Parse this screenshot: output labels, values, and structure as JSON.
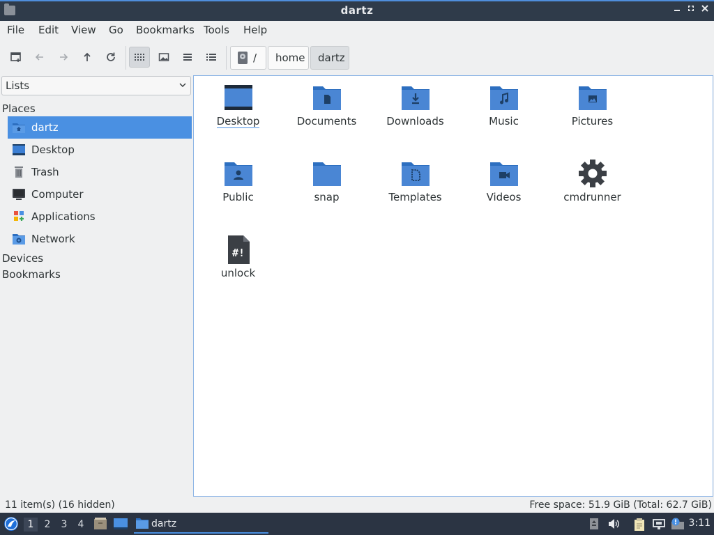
{
  "window": {
    "title": "dartz"
  },
  "menubar": {
    "items": [
      "File",
      "Edit",
      "View",
      "Go",
      "Bookmarks",
      "Tools",
      "Help"
    ]
  },
  "toolbar": {
    "buttons": [
      "new-tab-icon",
      "back-icon",
      "forward-icon",
      "up-icon",
      "reload-icon",
      "icon-view-icon",
      "thumbnail-view-icon",
      "compact-view-icon",
      "detailed-list-view-icon"
    ],
    "active_view": "icon-view",
    "path": [
      "/",
      "home",
      "dartz"
    ]
  },
  "sidebar": {
    "selector": "Lists",
    "places_label": "Places",
    "places": [
      {
        "label": "dartz",
        "icon": "home-folder-icon",
        "selected": true
      },
      {
        "label": "Desktop",
        "icon": "desktop-icon"
      },
      {
        "label": "Trash",
        "icon": "trash-icon"
      },
      {
        "label": "Computer",
        "icon": "computer-icon"
      },
      {
        "label": "Applications",
        "icon": "applications-icon"
      },
      {
        "label": "Network",
        "icon": "network-icon"
      }
    ],
    "devices_label": "Devices",
    "bookmarks_label": "Bookmarks"
  },
  "files": [
    {
      "name": "Desktop",
      "icon": "desktop-folder-icon"
    },
    {
      "name": "Documents",
      "icon": "documents-folder-icon"
    },
    {
      "name": "Downloads",
      "icon": "downloads-folder-icon"
    },
    {
      "name": "Music",
      "icon": "music-folder-icon"
    },
    {
      "name": "Pictures",
      "icon": "pictures-folder-icon"
    },
    {
      "name": "Public",
      "icon": "public-folder-icon"
    },
    {
      "name": "snap",
      "icon": "folder-icon"
    },
    {
      "name": "Templates",
      "icon": "templates-folder-icon"
    },
    {
      "name": "Videos",
      "icon": "videos-folder-icon"
    },
    {
      "name": "cmdrunner",
      "icon": "gear-icon"
    },
    {
      "name": "unlock",
      "icon": "script-file-icon"
    }
  ],
  "status": {
    "items": "11 item(s) (16 hidden)",
    "free_space": "Free space: 51.9 GiB (Total: 62.7 GiB)"
  },
  "taskbar": {
    "workspaces": [
      "1",
      "2",
      "3",
      "4"
    ],
    "active_workspace": "1",
    "window_label": "dartz",
    "clock": "3:11"
  },
  "colors": {
    "accent": "#4a90e2",
    "folder": "#4a86d4",
    "taskbar": "#2b3443",
    "titlebar": "#2f3b4a"
  }
}
